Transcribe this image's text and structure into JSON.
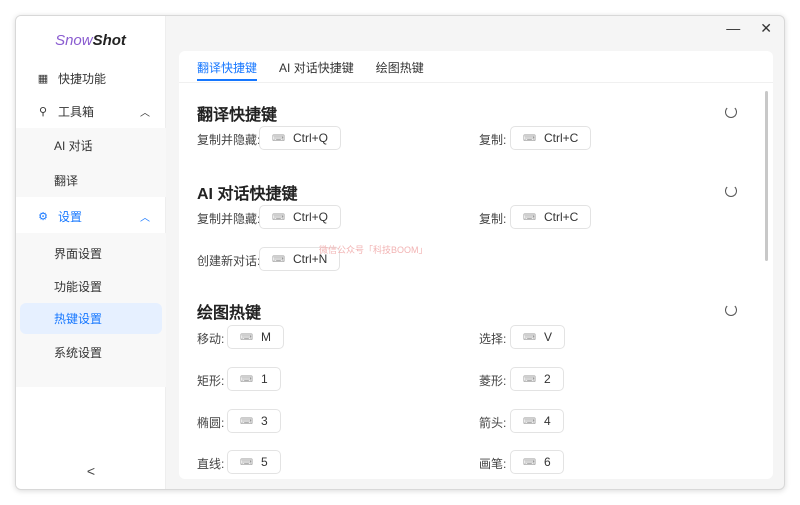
{
  "app": {
    "logo_a": "Snow",
    "logo_b": "Shot"
  },
  "sidebar": {
    "items": [
      {
        "label": "快捷功能",
        "icon": "grid-icon"
      },
      {
        "label": "工具箱",
        "icon": "wrench-icon"
      },
      {
        "label": "AI 对话"
      },
      {
        "label": "翻译"
      },
      {
        "label": "设置",
        "icon": "gear-icon"
      },
      {
        "label": "界面设置"
      },
      {
        "label": "功能设置"
      },
      {
        "label": "热键设置"
      },
      {
        "label": "系统设置"
      }
    ],
    "collapse": "<"
  },
  "window": {
    "minimize": "—",
    "close": "✕"
  },
  "tabs": [
    "翻译快捷键",
    "AI 对话快捷键",
    "绘图热键"
  ],
  "sections": [
    {
      "title": "翻译快捷键",
      "rows": [
        {
          "label": "复制并隐藏:",
          "key": "Ctrl+Q"
        },
        {
          "label": "复制:",
          "key": "Ctrl+C"
        }
      ]
    },
    {
      "title": "AI 对话快捷键",
      "rows": [
        {
          "label": "复制并隐藏:",
          "key": "Ctrl+Q"
        },
        {
          "label": "复制:",
          "key": "Ctrl+C"
        },
        {
          "label": "创建新对话:",
          "key": "Ctrl+N"
        }
      ]
    },
    {
      "title": "绘图热键",
      "rows": [
        {
          "label": "移动:",
          "key": "M"
        },
        {
          "label": "选择:",
          "key": "V"
        },
        {
          "label": "矩形:",
          "key": "1"
        },
        {
          "label": "菱形:",
          "key": "2"
        },
        {
          "label": "椭圆:",
          "key": "3"
        },
        {
          "label": "箭头:",
          "key": "4"
        },
        {
          "label": "直线:",
          "key": "5"
        },
        {
          "label": "画笔:",
          "key": "6"
        }
      ]
    }
  ],
  "watermark": "微信公众号「科技BOOM」",
  "colors": {
    "accent": "#1677ff",
    "logo": "#8a5cd0"
  }
}
